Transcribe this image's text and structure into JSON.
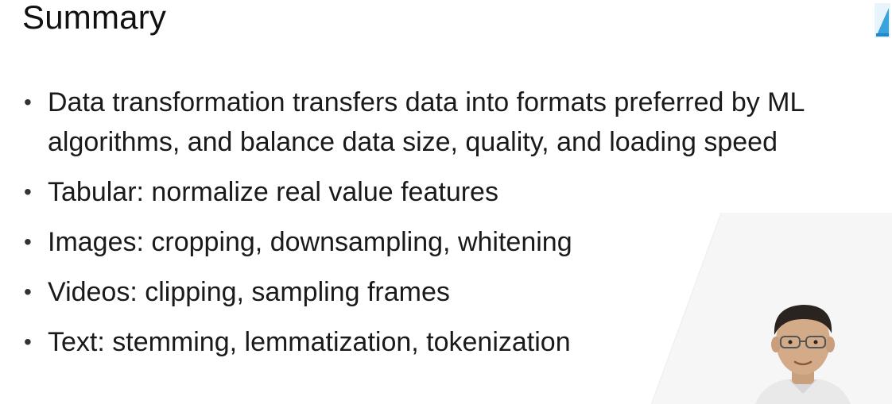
{
  "slide": {
    "title": "Summary",
    "bullets": [
      "Data transformation transfers data into formats preferred by ML algorithms, and balance data size, quality, and loading speed",
      "Tabular: normalize real value features",
      "Images: cropping, downsampling, whitening",
      "Videos: clipping, sampling frames",
      "Text: stemming, lemmatization, tokenization"
    ],
    "bullet_marker": "•"
  },
  "overlay": {
    "watermark_text": "",
    "presenter_icon": "presenter-video-icon"
  }
}
